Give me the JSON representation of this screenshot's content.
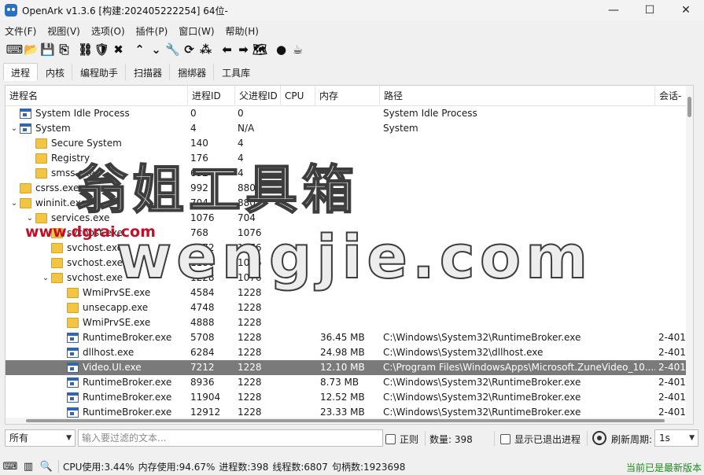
{
  "window": {
    "title": "OpenArk v1.3.6 [构建:202405222254]  64位-",
    "minimize_icon": "minimize-icon",
    "maximize_icon": "maximize-icon",
    "close_icon": "close-icon"
  },
  "menu": [
    "文件(F)",
    "视图(V)",
    "选项(O)",
    "插件(P)",
    "窗口(W)",
    "帮助(H)"
  ],
  "toolbar": [
    {
      "name": "console-icon",
      "glyph": "⌨"
    },
    {
      "name": "folder-open-icon",
      "glyph": "📂"
    },
    {
      "name": "save-icon",
      "glyph": "💾"
    },
    {
      "name": "export-icon",
      "glyph": "⎘"
    },
    {
      "name": "sep"
    },
    {
      "name": "tree-icon",
      "glyph": "⛓"
    },
    {
      "name": "shield-icon",
      "glyph": "🛡"
    },
    {
      "name": "kill-icon",
      "glyph": "✖"
    },
    {
      "name": "sep"
    },
    {
      "name": "arrow-up-icon",
      "glyph": "⌃"
    },
    {
      "name": "arrow-down-icon",
      "glyph": "⌄"
    },
    {
      "name": "wrench-icon",
      "glyph": "🔧"
    },
    {
      "name": "refresh-icon",
      "glyph": "⟳"
    },
    {
      "name": "grid-icon",
      "glyph": "⁂"
    },
    {
      "name": "sep"
    },
    {
      "name": "arrow-left-icon",
      "glyph": "⬅"
    },
    {
      "name": "arrow-right-icon",
      "glyph": "➡"
    },
    {
      "name": "map-icon",
      "glyph": "🗺"
    },
    {
      "name": "sep"
    },
    {
      "name": "github-icon",
      "glyph": "●"
    },
    {
      "name": "coffee-icon",
      "glyph": "☕"
    }
  ],
  "tabs": [
    "进程",
    "内核",
    "编程助手",
    "扫描器",
    "捆绑器",
    "工具库"
  ],
  "active_tab": 0,
  "columns": [
    "进程名",
    "进程ID",
    "父进程ID",
    "CPU",
    "内存",
    "路径",
    "会话-"
  ],
  "rows": [
    {
      "level": 0,
      "caret": "",
      "icon": "app",
      "name": "System Idle Process",
      "pid": "0",
      "ppid": "0",
      "cpu": "",
      "mem": "",
      "path": "System Idle Process",
      "session": ""
    },
    {
      "level": 0,
      "caret": "v",
      "icon": "app",
      "name": "System",
      "pid": "4",
      "ppid": "N/A",
      "cpu": "",
      "mem": "",
      "path": "System",
      "session": ""
    },
    {
      "level": 1,
      "caret": "",
      "icon": "folder",
      "name": "Secure System",
      "pid": "140",
      "ppid": "4",
      "cpu": "",
      "mem": "",
      "path": "",
      "session": ""
    },
    {
      "level": 1,
      "caret": "",
      "icon": "folder",
      "name": "Registry",
      "pid": "176",
      "ppid": "4",
      "cpu": "",
      "mem": "",
      "path": "",
      "session": ""
    },
    {
      "level": 1,
      "caret": "",
      "icon": "folder",
      "name": "smss.exe",
      "pid": "632",
      "ppid": "4",
      "cpu": "",
      "mem": "",
      "path": "",
      "session": ""
    },
    {
      "level": 0,
      "caret": "",
      "icon": "folder",
      "name": "csrss.exe",
      "pid": "992",
      "ppid": "880",
      "cpu": "",
      "mem": "",
      "path": "",
      "session": ""
    },
    {
      "level": 0,
      "caret": "v",
      "icon": "folder",
      "name": "wininit.exe",
      "pid": "704",
      "ppid": "880",
      "cpu": "",
      "mem": "",
      "path": "",
      "session": ""
    },
    {
      "level": 1,
      "caret": "v",
      "icon": "folder",
      "name": "services.exe",
      "pid": "1076",
      "ppid": "704",
      "cpu": "",
      "mem": "",
      "path": "",
      "session": ""
    },
    {
      "level": 2,
      "caret": "",
      "icon": "folder",
      "name": "svchost.exe",
      "pid": "768",
      "ppid": "1076",
      "cpu": "",
      "mem": "",
      "path": "",
      "session": ""
    },
    {
      "level": 2,
      "caret": "",
      "icon": "folder",
      "name": "svchost.exe",
      "pid": "1172",
      "ppid": "1076",
      "cpu": "",
      "mem": "",
      "path": "",
      "session": ""
    },
    {
      "level": 2,
      "caret": "",
      "icon": "folder",
      "name": "svchost.exe",
      "pid": "1180",
      "ppid": "1076",
      "cpu": "",
      "mem": "",
      "path": "",
      "session": ""
    },
    {
      "level": 2,
      "caret": "v",
      "icon": "folder",
      "name": "svchost.exe",
      "pid": "1228",
      "ppid": "1076",
      "cpu": "",
      "mem": "",
      "path": "",
      "session": ""
    },
    {
      "level": 3,
      "caret": "",
      "icon": "folder",
      "name": "WmiPrvSE.exe",
      "pid": "4584",
      "ppid": "1228",
      "cpu": "",
      "mem": "",
      "path": "",
      "session": ""
    },
    {
      "level": 3,
      "caret": "",
      "icon": "folder",
      "name": "unsecapp.exe",
      "pid": "4748",
      "ppid": "1228",
      "cpu": "",
      "mem": "",
      "path": "",
      "session": ""
    },
    {
      "level": 3,
      "caret": "",
      "icon": "folder",
      "name": "WmiPrvSE.exe",
      "pid": "4888",
      "ppid": "1228",
      "cpu": "",
      "mem": "",
      "path": "",
      "session": ""
    },
    {
      "level": 3,
      "caret": "",
      "icon": "app",
      "name": "RuntimeBroker.exe",
      "pid": "5708",
      "ppid": "1228",
      "cpu": "",
      "mem": "36.45 MB",
      "path": "C:\\Windows\\System32\\RuntimeBroker.exe",
      "session": "2-401"
    },
    {
      "level": 3,
      "caret": "",
      "icon": "app",
      "name": "dllhost.exe",
      "pid": "6284",
      "ppid": "1228",
      "cpu": "",
      "mem": "24.98 MB",
      "path": "C:\\Windows\\System32\\dllhost.exe",
      "session": "2-401"
    },
    {
      "level": 3,
      "caret": "",
      "icon": "app",
      "name": "Video.UI.exe",
      "pid": "7212",
      "ppid": "1228",
      "cpu": "",
      "mem": "12.10 MB",
      "path": "C:\\Program Files\\WindowsApps\\Microsoft.ZuneVideo_10....",
      "session": "2-401",
      "selected": true
    },
    {
      "level": 3,
      "caret": "",
      "icon": "app",
      "name": "RuntimeBroker.exe",
      "pid": "8936",
      "ppid": "1228",
      "cpu": "",
      "mem": "8.73 MB",
      "path": "C:\\Windows\\System32\\RuntimeBroker.exe",
      "session": "2-401"
    },
    {
      "level": 3,
      "caret": "",
      "icon": "app",
      "name": "RuntimeBroker.exe",
      "pid": "11904",
      "ppid": "1228",
      "cpu": "",
      "mem": "12.52 MB",
      "path": "C:\\Windows\\System32\\RuntimeBroker.exe",
      "session": "2-401"
    },
    {
      "level": 3,
      "caret": "",
      "icon": "app",
      "name": "RuntimeBroker.exe",
      "pid": "12912",
      "ppid": "1228",
      "cpu": "",
      "mem": "23.33 MB",
      "path": "C:\\Windows\\System32\\RuntimeBroker.exe",
      "session": "2-401"
    }
  ],
  "watermark": {
    "cn": "翁姐工具箱",
    "domain": "wengjie.com",
    "url": "www.dgrai.com"
  },
  "filter": {
    "scope": "所有",
    "placeholder": "输入要过滤的文本...",
    "regex_label": "正则",
    "count_label": "数量: 398",
    "show_exited_label": "显示已退出进程",
    "refresh_label": "刷新周期:",
    "refresh_value": "1s"
  },
  "status": {
    "cpu": "CPU使用:3.44%",
    "mem": "内存使用:94.67%",
    "procs": "进程数:398",
    "threads": "线程数:6807",
    "handles": "句柄数:1923698",
    "version": "当前已是最新版本"
  }
}
